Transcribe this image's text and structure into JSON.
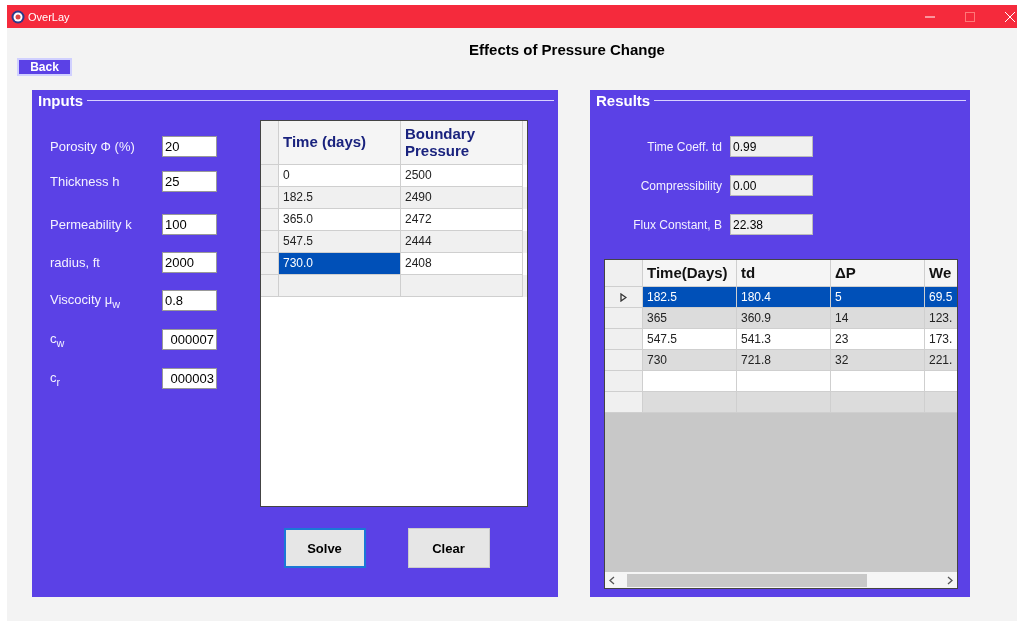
{
  "window": {
    "title": "OverLay"
  },
  "heading": "Effects of Pressure Change",
  "back_button": "Back",
  "inputs": {
    "title": "Inputs",
    "fields": [
      {
        "label": "Porosity Φ (%)",
        "value": "20"
      },
      {
        "label": "Thickness h",
        "value": "25"
      },
      {
        "label": "Permeability k",
        "value": "100"
      },
      {
        "label": "radius, ft",
        "value": "2000"
      },
      {
        "label": "Viscocity μ$_{w}$",
        "value": "0.8"
      },
      {
        "label": "c$_{w}$",
        "value": "000007"
      },
      {
        "label": "c$_{r}$",
        "value": "000003"
      }
    ]
  },
  "pressure_table": {
    "columns": [
      "Time (days)",
      "Boundary Pressure"
    ],
    "rows": [
      {
        "cells": [
          "0",
          "2500"
        ],
        "selected": false
      },
      {
        "cells": [
          "182.5",
          "2490"
        ],
        "selected": false
      },
      {
        "cells": [
          "365.0",
          "2472"
        ],
        "selected": false
      },
      {
        "cells": [
          "547.5",
          "2444"
        ],
        "selected": false
      },
      {
        "cells": [
          "730.0",
          "2408"
        ],
        "selected": true
      }
    ]
  },
  "buttons": [
    {
      "label": "Solve",
      "focused": true
    },
    {
      "label": "Clear",
      "focused": false
    }
  ],
  "results": {
    "title": "Results",
    "fields": [
      {
        "label": "Time Coeff. td",
        "value": "0.99"
      },
      {
        "label": "Compressibility",
        "value": "0.00"
      },
      {
        "label": "Flux Constant, B",
        "value": "22.38"
      }
    ],
    "table": {
      "columns": [
        "Time(Days)",
        "td",
        "ΔP",
        "We"
      ],
      "rows": [
        {
          "cells": [
            "182.5",
            "180.4",
            "5",
            "69.5"
          ],
          "selected": true
        },
        {
          "cells": [
            "365",
            "360.9",
            "14",
            "123."
          ],
          "selected": false
        },
        {
          "cells": [
            "547.5",
            "541.3",
            "23",
            "173."
          ],
          "selected": false
        },
        {
          "cells": [
            "730",
            "721.8",
            "32",
            "221."
          ],
          "selected": false
        }
      ]
    }
  }
}
